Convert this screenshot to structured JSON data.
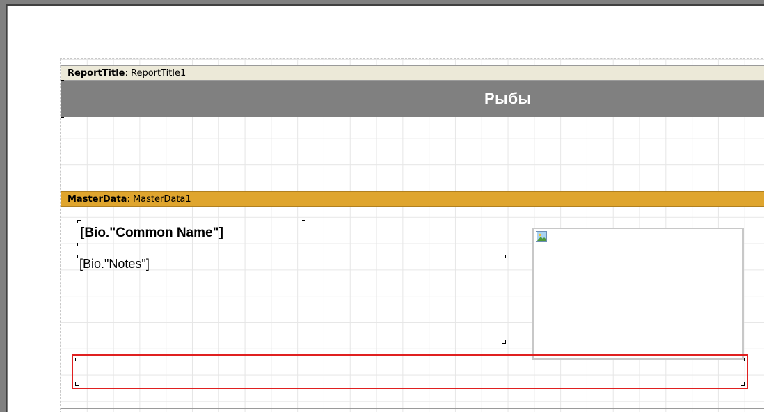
{
  "report_title_band": {
    "type_label": "ReportTitle",
    "name": ": ReportTitle1",
    "title_text": "Рыбы"
  },
  "master_data_band": {
    "type_label": "MasterData",
    "name": ": MasterData1",
    "common_name_field": "[Bio.\"Common Name\"]",
    "notes_field": "[Bio.\"Notes\"]"
  },
  "colors": {
    "report_title_header": "#ece9d8",
    "title_bar": "#808080",
    "master_data_header": "#dfa52e",
    "selection": "#e02020"
  },
  "icons": {
    "picture_object": "picture-placeholder-icon"
  }
}
